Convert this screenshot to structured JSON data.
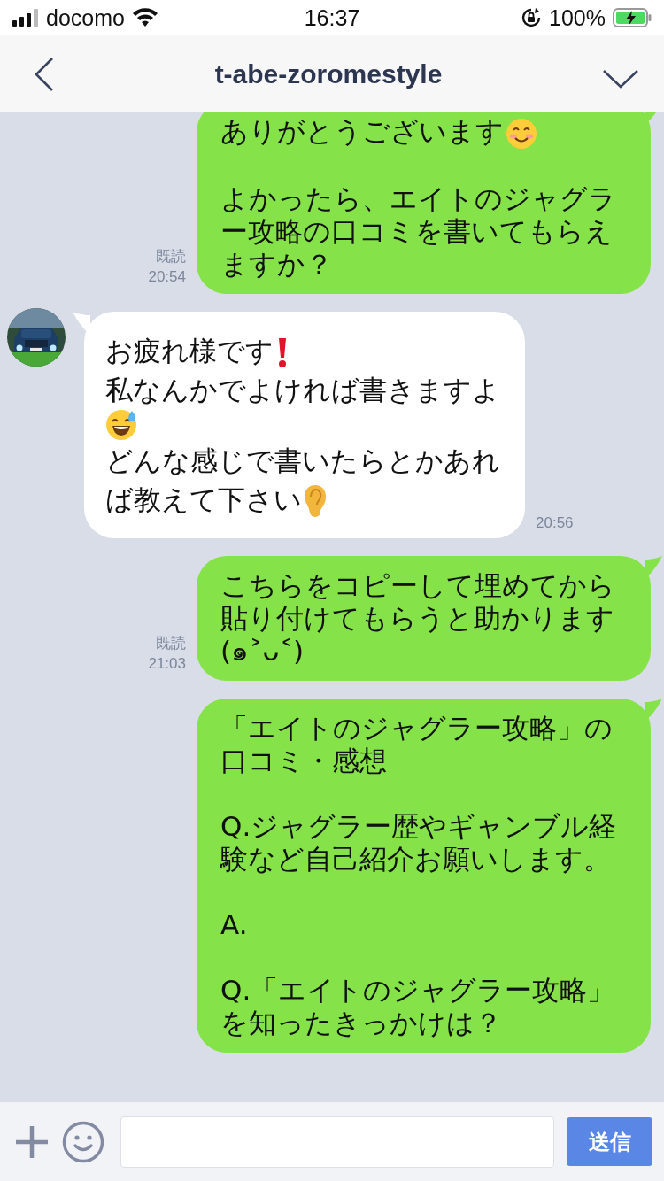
{
  "status_bar": {
    "carrier": "docomo",
    "time": "16:37",
    "battery": "100%"
  },
  "header": {
    "title": "t-abe-zoromestyle"
  },
  "messages": [
    {
      "kind": "sent",
      "read": "既読",
      "time": "20:54",
      "paragraphs": [
        {
          "lines": [
            {
              "text": "ありがとうございます",
              "kind": "smile"
            }
          ]
        },
        {
          "lines": [
            {
              "text": "よかったら、エイトのジャグラー攻略の口コミを書いてもらえますか？"
            }
          ]
        }
      ]
    },
    {
      "kind": "received",
      "time": "20:56",
      "paragraphs": [
        {
          "lines": [
            {
              "text": "お疲れ様です",
              "kind": "exclamation"
            },
            {
              "text": "私なんかでよければ書きますよ",
              "kind": "sweat"
            },
            {
              "text": "どんな感じで書いたらとかあれ",
              "kind": "plain"
            },
            {
              "text": "ば教えて下さい",
              "kind": "ear"
            }
          ]
        }
      ]
    },
    {
      "kind": "sent",
      "read": "既読",
      "time": "21:03",
      "paragraphs": [
        {
          "lines": [
            {
              "text": "こちらをコピーして埋めてから貼り付けてもらうと助かります"
            },
            {
              "text": "(๑˃ᴗ˂)"
            }
          ]
        }
      ]
    },
    {
      "kind": "sent",
      "paragraphs": [
        {
          "lines": [
            {
              "text": "「エイトのジャグラー攻略」の口コミ・感想"
            }
          ]
        },
        {
          "lines": [
            {
              "text": "Q.ジャグラー歴やギャンブル経験など自己紹介お願いします。"
            }
          ]
        },
        {
          "lines": [
            {
              "text": "A."
            }
          ]
        },
        {
          "lines": [
            {
              "text": "Q.「エイトのジャグラー攻略」を知ったきっかけは？"
            }
          ]
        }
      ]
    }
  ],
  "composer": {
    "send_label": "送信"
  }
}
